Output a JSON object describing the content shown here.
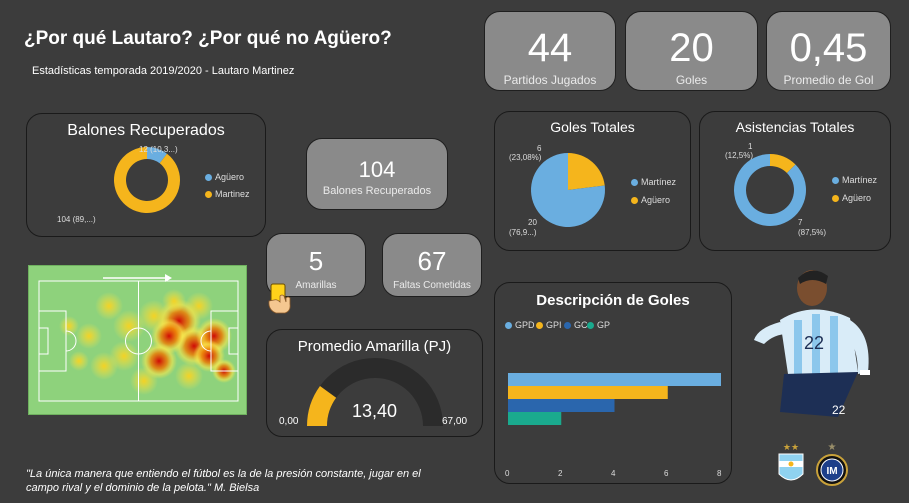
{
  "header": {
    "title": "¿Por qué Lautaro? ¿Por qué no Agüero?",
    "subtitle": "Estadísticas temporada 2019/2020 - Lautaro Martinez"
  },
  "kpis": {
    "partidos": {
      "value": "44",
      "label": "Partidos Jugados"
    },
    "goles": {
      "value": "20",
      "label": "Goles"
    },
    "promedio": {
      "value": "0,45",
      "label": "Promedio de Gol"
    },
    "balones": {
      "value": "104",
      "label": "Balones Recuperados"
    },
    "amarillas": {
      "value": "5",
      "label": "Amarillas"
    },
    "faltas": {
      "value": "67",
      "label": "Faltas Cometidas"
    }
  },
  "balones_chart": {
    "title": "Balones Recuperados",
    "label_aguero": "12 (10,3...)",
    "label_martinez": "104 (89,...)",
    "legend": [
      "Agüero",
      "Martinez"
    ]
  },
  "goles_chart": {
    "title": "Goles Totales",
    "label_aguero_1": "6",
    "label_aguero_2": "(23,08%)",
    "label_martinez_1": "20",
    "label_martinez_2": "(76,9...)",
    "legend": [
      "Martínez",
      "Agüero"
    ]
  },
  "asistencias_chart": {
    "title": "Asistencias Totales",
    "label_aguero_1": "1",
    "label_aguero_2": "(12,5%)",
    "label_martinez_1": "7",
    "label_martinez_2": "(87,5%)",
    "legend": [
      "Martínez",
      "Agüero"
    ]
  },
  "gauge": {
    "title": "Promedio Amarilla (PJ)",
    "value": "13,40",
    "min": "0,00",
    "max": "67,00"
  },
  "descripcion": {
    "title": "Descripción de Goles",
    "legend": [
      "GPD",
      "GPI",
      "GC",
      "GP"
    ],
    "ticks": [
      "0",
      "2",
      "4",
      "6",
      "8"
    ]
  },
  "quote": "\"La única manera que entiendo el fútbol es la de la presión constante, jugar en el campo rival y el dominio de la pelota.\" M. Bielsa",
  "colors": {
    "blue": "#6aaee0",
    "orange": "#f5b51c",
    "darkblue": "#2a66ad",
    "teal": "#1aaa8e",
    "card_gray": "#8a8a8a"
  },
  "chart_data": [
    {
      "type": "pie",
      "title": "Balones Recuperados",
      "categories": [
        "Agüero",
        "Martinez"
      ],
      "values": [
        12,
        104
      ]
    },
    {
      "type": "pie",
      "title": "Goles Totales",
      "categories": [
        "Martínez",
        "Agüero"
      ],
      "values": [
        20,
        6
      ]
    },
    {
      "type": "pie",
      "title": "Asistencias Totales",
      "categories": [
        "Martínez",
        "Agüero"
      ],
      "values": [
        7,
        1
      ]
    },
    {
      "type": "bar",
      "title": "Descripción de Goles",
      "orientation": "horizontal",
      "series": [
        {
          "name": "GPD",
          "values": [
            8
          ]
        },
        {
          "name": "GPI",
          "values": [
            6
          ]
        },
        {
          "name": "GC",
          "values": [
            4
          ]
        },
        {
          "name": "GP",
          "values": [
            2
          ]
        }
      ],
      "xlim": [
        0,
        8
      ]
    },
    {
      "type": "gauge",
      "title": "Promedio Amarilla (PJ)",
      "value": 13.4,
      "min": 0,
      "max": 67
    }
  ]
}
